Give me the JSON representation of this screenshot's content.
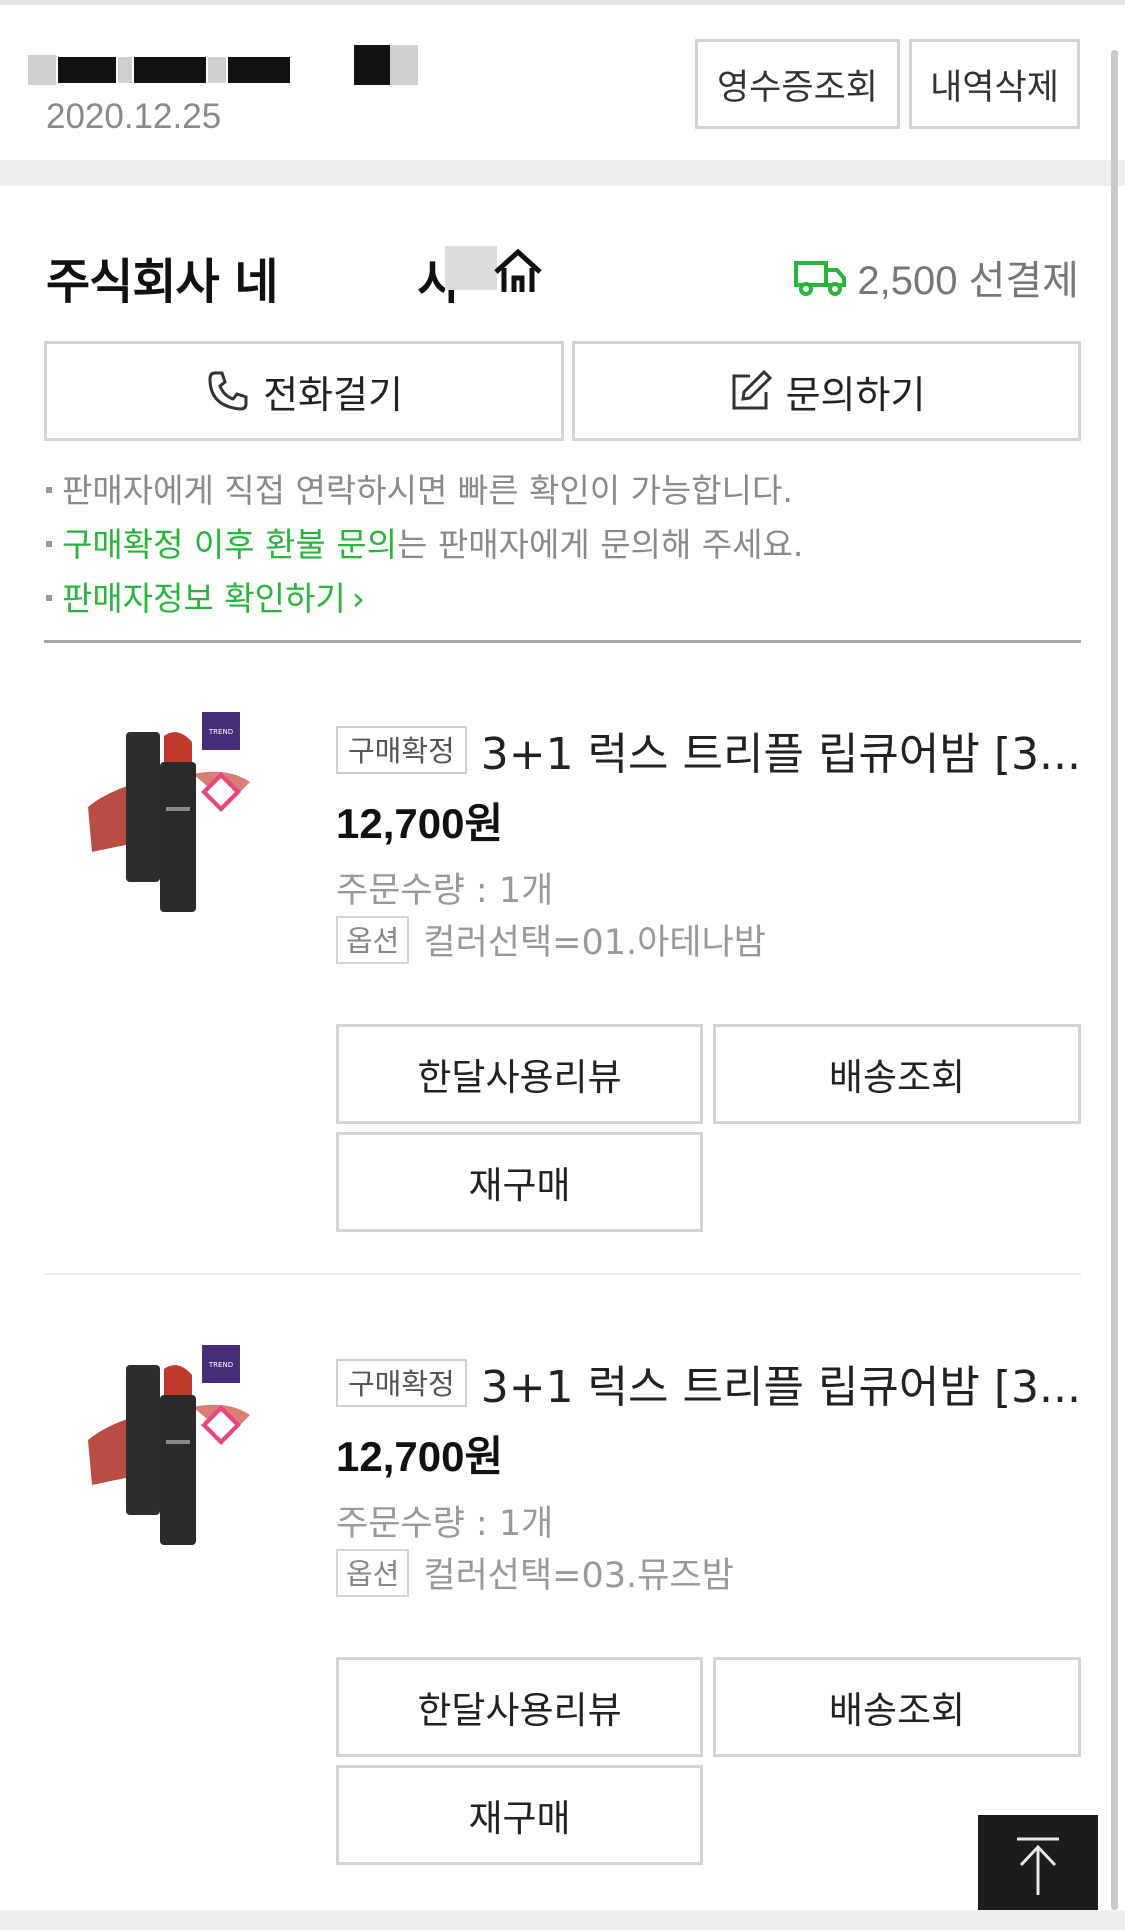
{
  "header": {
    "order_date": "2020.12.25",
    "receipt_label": "영수증조회",
    "delete_label": "내역삭제"
  },
  "seller": {
    "name": "주식회사 네",
    "name_suffix": "사",
    "shipping": "2,500 선결제",
    "call_label": "전화걸기",
    "inquiry_label": "문의하기",
    "notes": {
      "line1": "판매자에게 직접 연락하시면 빠른 확인이 가능합니다.",
      "line2_green": "구매확정 이후 환불 문의",
      "line2_rest": "는 판매자에게 문의해 주세요.",
      "line3_green": "판매자정보 확인하기",
      "line3_arrow": "›"
    }
  },
  "items": [
    {
      "status": "구매확정",
      "title": "3+1 럭스 트리플 립큐어밤 [3...",
      "price": "12,700원",
      "qty": "주문수량 : 1개",
      "option_badge": "옵션",
      "option": "컬러선택=01.아테나밤",
      "review_label": "한달사용리뷰",
      "track_label": "배송조회",
      "rebuy_label": "재구매"
    },
    {
      "status": "구매확정",
      "title": "3+1 럭스 트리플 립큐어밤 [3...",
      "price": "12,700원",
      "qty": "주문수량 : 1개",
      "option_badge": "옵션",
      "option": "컬러선택=03.뮤즈밤",
      "review_label": "한달사용리뷰",
      "track_label": "배송조회",
      "rebuy_label": "재구매"
    }
  ],
  "icons": {
    "home": "home-icon",
    "truck": "truck-icon",
    "phone": "phone-icon",
    "edit": "edit-icon",
    "arrow_up": "arrow-up-icon"
  },
  "colors": {
    "accent_green": "#28b53b"
  }
}
